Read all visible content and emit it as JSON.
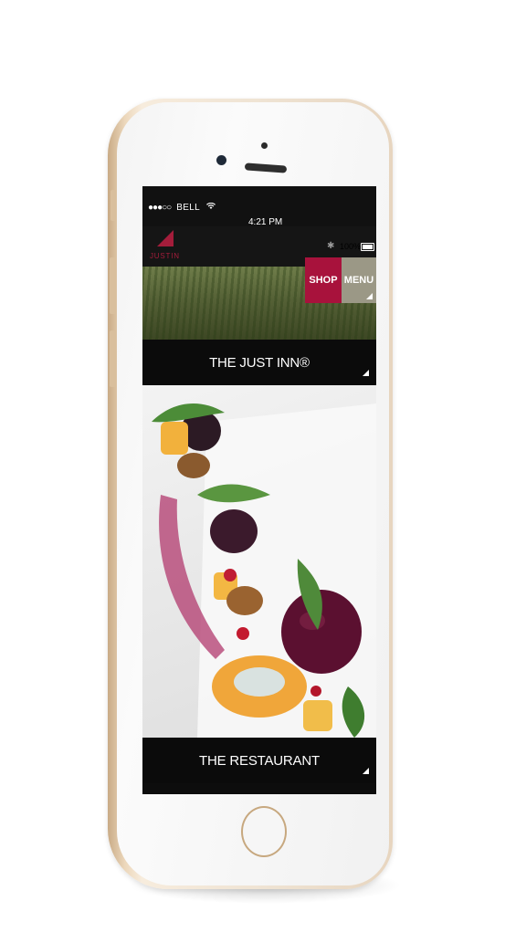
{
  "status_bar": {
    "carrier": "BELL",
    "time": "4:21 PM",
    "battery": "100%"
  },
  "header": {
    "logo_text": "JUSTIN",
    "shop_label": "SHOP",
    "menu_label": "MENU"
  },
  "sections": [
    {
      "label": "THE JUST INN®"
    },
    {
      "label": "THE RESTAURANT"
    }
  ],
  "colors": {
    "brand_red": "#a8123c",
    "menu_taupe": "#9b9886",
    "bar_black": "#0b0b0b",
    "phone_gold": "#ecd7bb"
  },
  "icons": [
    "wifi-icon",
    "bluetooth-icon",
    "battery-icon",
    "corner-arrow-icon"
  ]
}
